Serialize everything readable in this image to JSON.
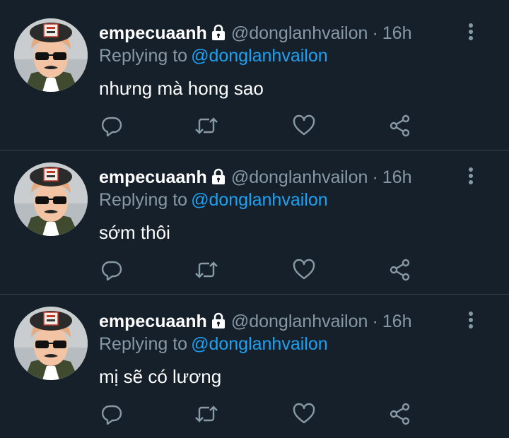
{
  "colors": {
    "background": "#15202b",
    "divider": "#38444d",
    "primary_text": "#ffffff",
    "secondary_text": "#8899a6",
    "accent": "#1da1f2"
  },
  "icons": {
    "protected": "lock-icon",
    "more": "more-vertical-icon",
    "reply": "reply-icon",
    "retweet": "retweet-icon",
    "like": "heart-icon",
    "share": "share-icon"
  },
  "tweets": [
    {
      "display_name": "empecuaanh",
      "handle": "@donglanhvailon",
      "separator": "·",
      "time": "16h",
      "replying_label": "Replying to",
      "replying_to": "@donglanhvailon",
      "text": "nhưng mà hong sao"
    },
    {
      "display_name": "empecuaanh",
      "handle": "@donglanhvailon",
      "separator": "·",
      "time": "16h",
      "replying_label": "Replying to",
      "replying_to": "@donglanhvailon",
      "text": "sớm thôi"
    },
    {
      "display_name": "empecuaanh",
      "handle": "@donglanhvailon",
      "separator": "·",
      "time": "16h",
      "replying_label": "Replying to",
      "replying_to": "@donglanhvailon",
      "text": "mị sẽ có lương"
    }
  ]
}
